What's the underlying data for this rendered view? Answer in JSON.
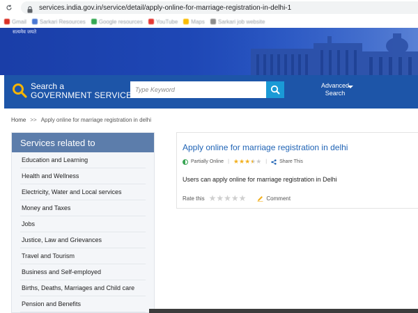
{
  "browser": {
    "url": "services.india.gov.in/service/detail/apply-online-for-marriage-registration-in-delhi-1",
    "bookmarks": [
      "Gmail",
      "Sarkari Resources",
      "Google resources",
      "YouTube",
      "Maps",
      "Sarkari job website"
    ]
  },
  "hero": {
    "emblem_caption": "सत्यमेव जयते"
  },
  "search": {
    "title_line1": "Search a",
    "title_line2": "GOVERNMENT SERVICE",
    "placeholder": "Type Keyword",
    "advanced_line1": "Advanced",
    "advanced_line2": "Search"
  },
  "breadcrumb": {
    "home": "Home",
    "separator": ">>",
    "current": "Apply online for marriage registration in delhi"
  },
  "sidebar": {
    "heading": "Services related to",
    "items": [
      {
        "label": "Education and Learning"
      },
      {
        "label": "Health and Wellness"
      },
      {
        "label": "Electricity, Water and Local services"
      },
      {
        "label": "Money and Taxes"
      },
      {
        "label": "Jobs"
      },
      {
        "label": "Justice, Law and Grievances"
      },
      {
        "label": "Travel and Tourism"
      },
      {
        "label": "Business and Self-employed"
      },
      {
        "label": "Births, Deaths, Marriages and Child care"
      },
      {
        "label": "Pension and Benefits"
      }
    ]
  },
  "service": {
    "title": "Apply online for marriage registration in delhi",
    "status": "Partially Online",
    "rating": 3.5,
    "rating_max": 5,
    "share_label": "Share This",
    "description": "Users can apply online for marriage registration in Delhi",
    "rate_label": "Rate this",
    "comment_label": "Comment"
  },
  "colors": {
    "hero_blue": "#1e47b5",
    "band_blue": "#1d55a8",
    "search_btn": "#1a9ad6",
    "sidebar_head": "#5c7dab",
    "title_blue": "#1f63b5",
    "star_gold": "#f2b01e",
    "online_green": "#3aa655"
  }
}
